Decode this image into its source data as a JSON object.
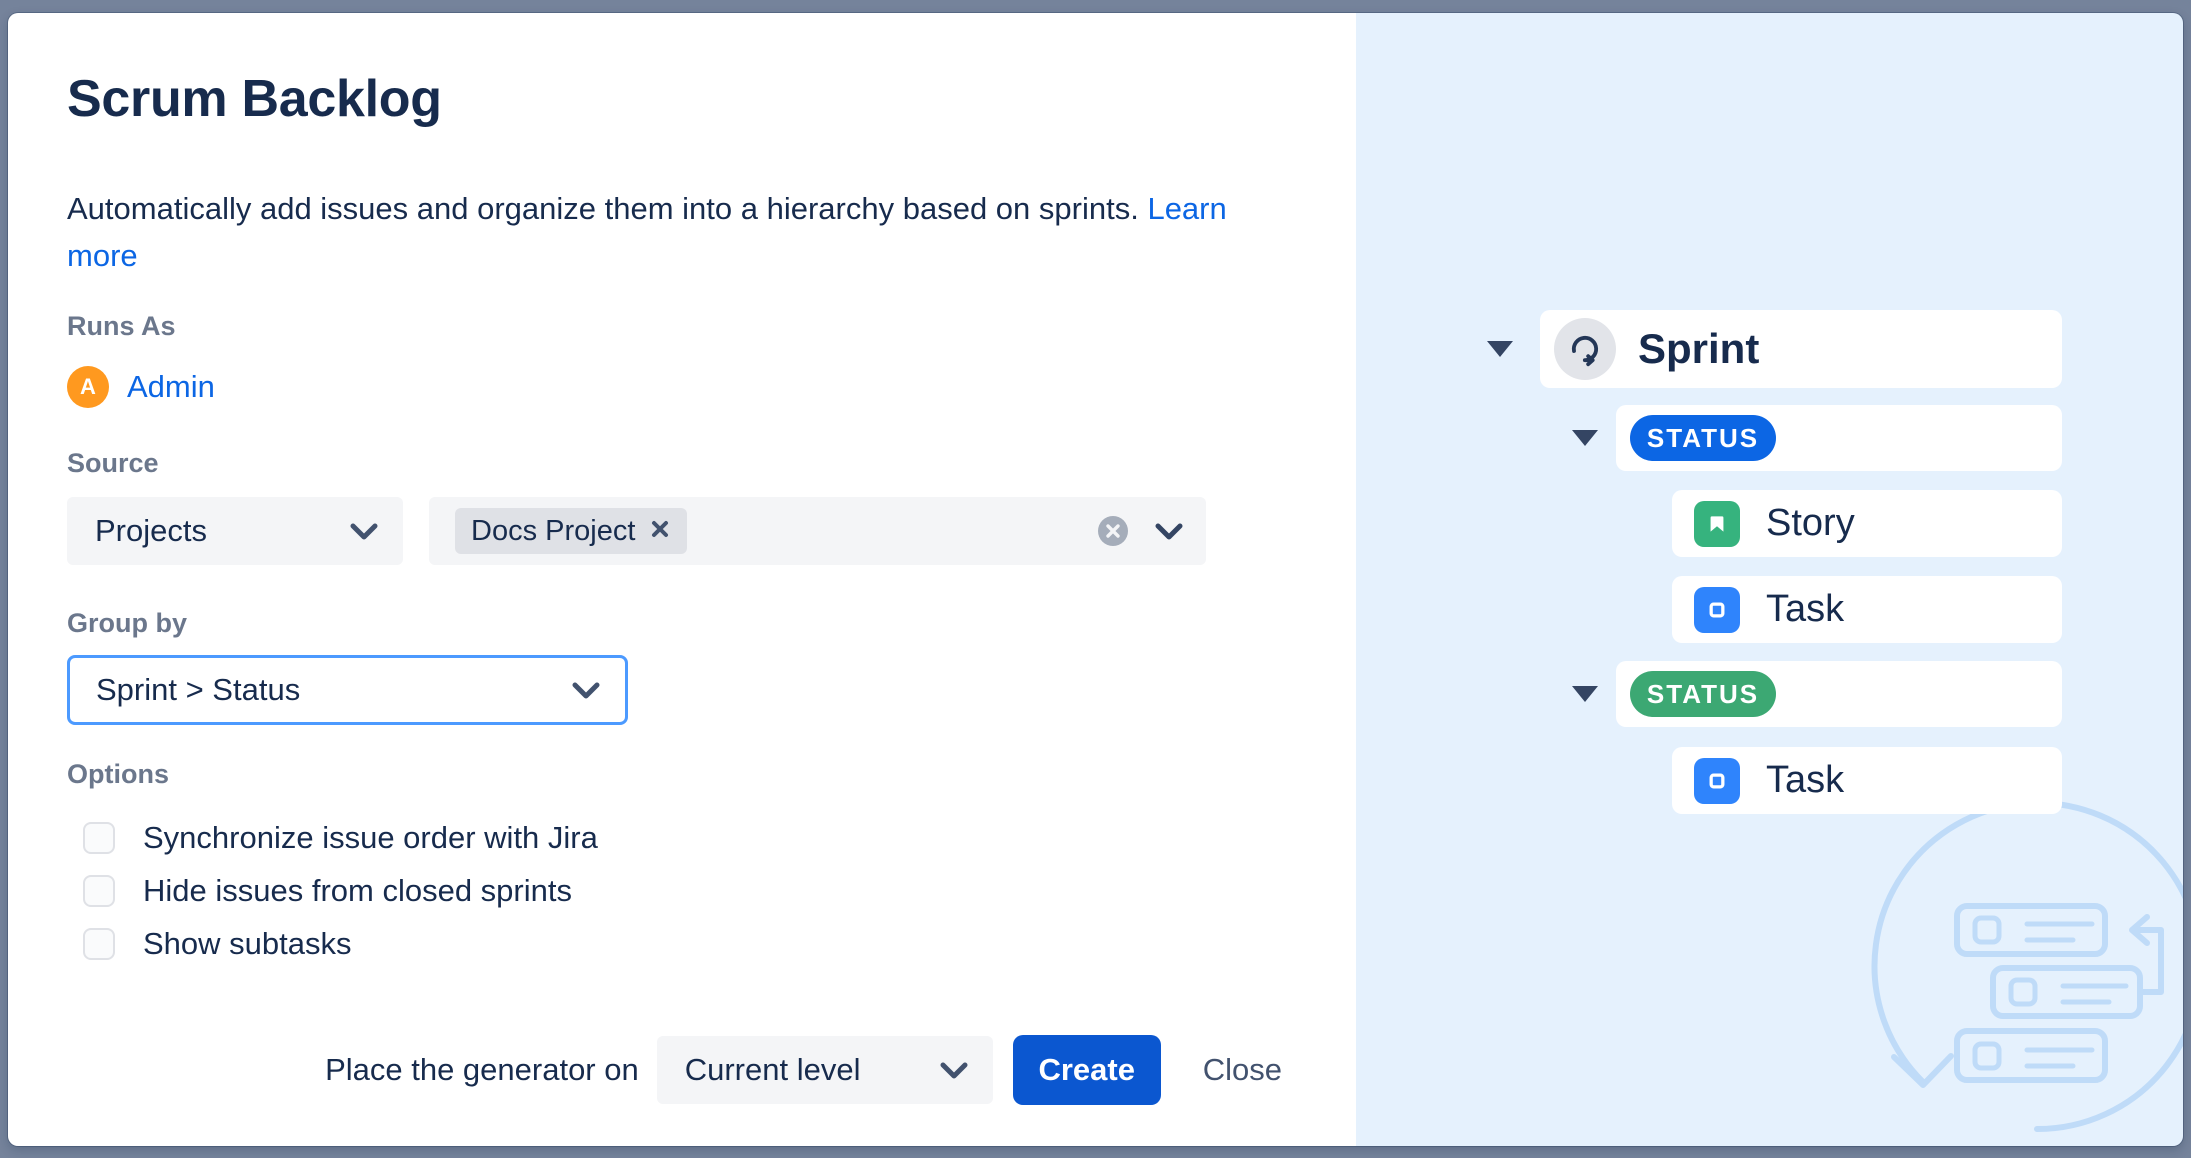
{
  "dialog": {
    "title": "Scrum Backlog",
    "description": "Automatically add issues and organize them into a hierarchy based on sprints.",
    "learn_more_label": "Learn more",
    "runs_as": {
      "label": "Runs As",
      "avatar_initial": "A",
      "user": "Admin"
    },
    "source": {
      "label": "Source",
      "type_selected": "Projects",
      "selected_tag": "Docs Project"
    },
    "group_by": {
      "label": "Group by",
      "selected": "Sprint > Status"
    },
    "options": {
      "label": "Options",
      "items": [
        {
          "label": "Synchronize issue order with Jira",
          "checked": false
        },
        {
          "label": "Hide issues from closed sprints",
          "checked": false
        },
        {
          "label": "Show subtasks",
          "checked": false
        }
      ]
    },
    "footer": {
      "placement_label": "Place the generator on",
      "placement_selected": "Current level",
      "create_label": "Create",
      "close_label": "Close"
    }
  },
  "preview": {
    "rows": [
      {
        "type": "sprint",
        "label": "Sprint",
        "icon": "sprint-icon",
        "collapsed": false
      },
      {
        "type": "status",
        "label": "STATUS",
        "color": "blue",
        "collapsed": false
      },
      {
        "type": "issue",
        "label": "Story",
        "icon": "story-icon"
      },
      {
        "type": "issue",
        "label": "Task",
        "icon": "task-icon"
      },
      {
        "type": "status",
        "label": "STATUS",
        "color": "green",
        "collapsed": false
      },
      {
        "type": "issue",
        "label": "Task",
        "icon": "task-icon"
      }
    ]
  },
  "icons": {
    "chevron": "chevron-down-icon",
    "tag_remove": "close-icon",
    "field_clear": "clear-circle-icon",
    "collapse": "collapse-triangle-icon"
  },
  "colors": {
    "text_dark": "#172B4D",
    "label_gray": "#6B778C",
    "link_blue": "#0C66E4",
    "create_button": "#0B57D0",
    "focus_border": "#4C9AFF",
    "control_bg": "#F4F5F7",
    "tag_bg": "#DFE1E6",
    "panel_blue": "#E5F1FD",
    "badge_blue": "#0C66E4",
    "badge_green": "#3CA873",
    "story_green": "#36B37E",
    "task_blue": "#2F84FC",
    "avatar_orange": "#FF991F",
    "frame_slate": "#75839B",
    "illustration_stroke": "#BFDBF8"
  }
}
